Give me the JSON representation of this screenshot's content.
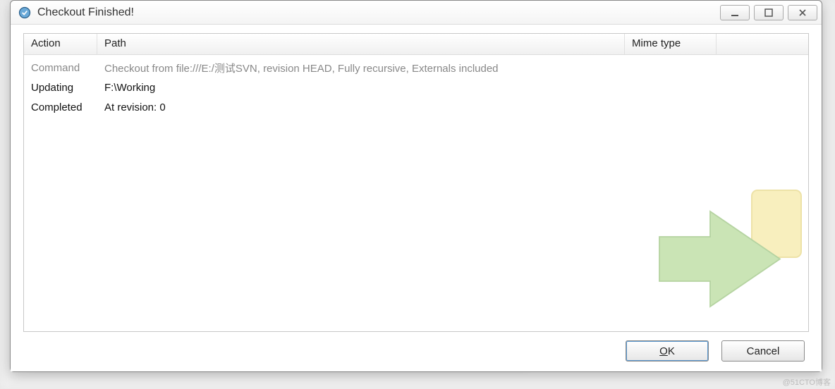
{
  "window": {
    "title": "Checkout Finished!"
  },
  "columns": {
    "action": "Action",
    "path": "Path",
    "mime": "Mime type"
  },
  "rows": [
    {
      "kind": "cmd",
      "action": "Command",
      "path": "Checkout from file:///E:/测试SVN, revision HEAD, Fully recursive, Externals included",
      "mime": ""
    },
    {
      "kind": "upd",
      "action": "Updating",
      "path": "F:\\Working",
      "mime": ""
    },
    {
      "kind": "completed",
      "action": "Completed",
      "path": "At revision: 0",
      "mime": ""
    }
  ],
  "buttons": {
    "ok": "OK",
    "cancel": "Cancel"
  },
  "watermark_text": "@51CTO博客"
}
